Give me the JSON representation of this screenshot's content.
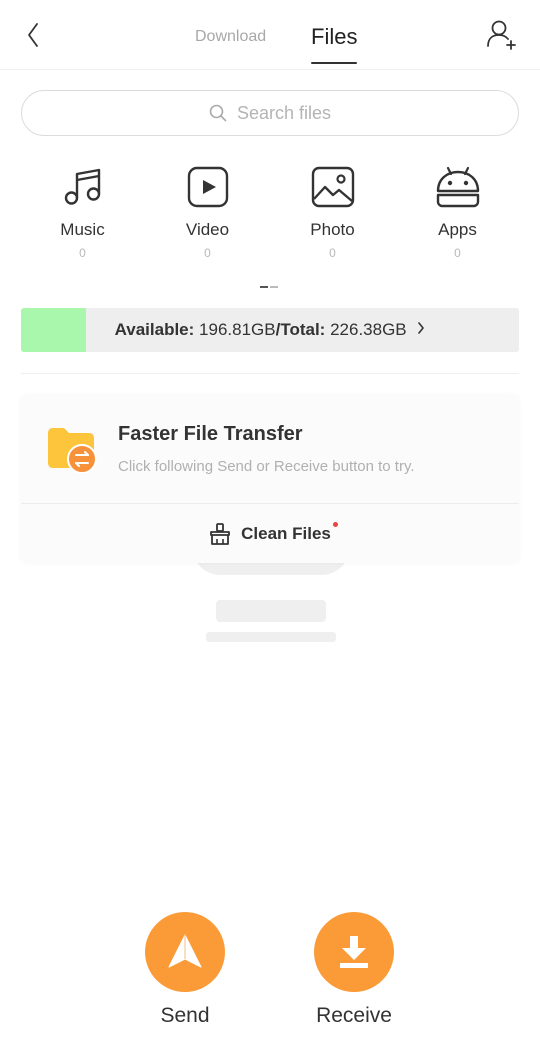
{
  "header": {
    "tabs": [
      {
        "label": "Download",
        "active": false
      },
      {
        "label": "Files",
        "active": true
      }
    ],
    "back_icon": "chevron-left-icon",
    "add_user_icon": "add-user-icon"
  },
  "search": {
    "placeholder": "Search files",
    "icon": "search-icon"
  },
  "categories": [
    {
      "label": "Music",
      "count": "0",
      "icon": "music-icon"
    },
    {
      "label": "Video",
      "count": "0",
      "icon": "video-icon"
    },
    {
      "label": "Photo",
      "count": "0",
      "icon": "photo-icon"
    },
    {
      "label": "Apps",
      "count": "0",
      "icon": "android-icon"
    }
  ],
  "pager": {
    "pages": 2,
    "active": 1
  },
  "storage": {
    "available_label": "Available:",
    "available_value": "196.81GB",
    "separator": "/",
    "total_label": "Total:",
    "total_value": "226.38GB",
    "used_fraction": 0.13,
    "fill_color": "#a9f7ad"
  },
  "transfer_card": {
    "title": "Faster File Transfer",
    "subtitle": "Click following Send or Receive button to try.",
    "icon": "folder-transfer-icon",
    "clean_label": "Clean Files",
    "clean_icon": "broom-icon",
    "has_notification": true
  },
  "actions": {
    "send_label": "Send",
    "receive_label": "Receive",
    "accent_color": "#fa9b38"
  }
}
